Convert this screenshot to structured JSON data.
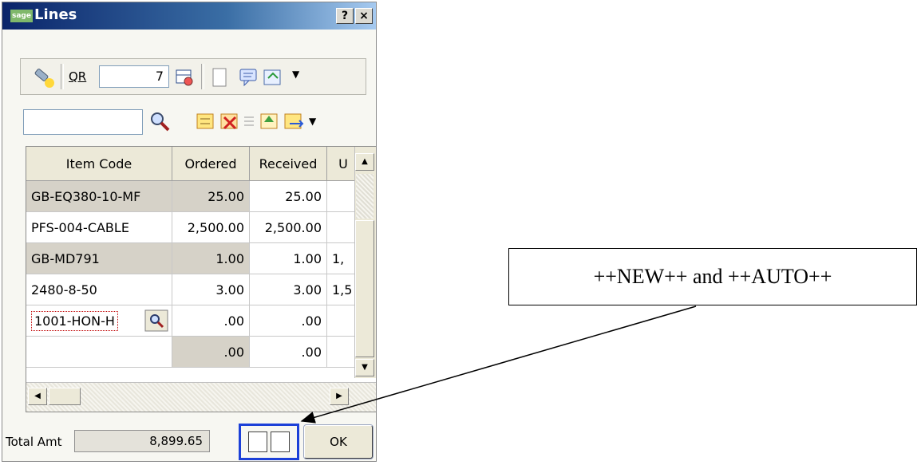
{
  "window": {
    "title": "Lines",
    "logo": "sage",
    "help_label": "?",
    "close_label": "×"
  },
  "toolbar": {
    "qr_label": "QR",
    "qr_value": "7"
  },
  "grid": {
    "columns": [
      "Item Code",
      "Ordered",
      "Received",
      "U"
    ],
    "rows": [
      {
        "code": "GB-EQ380-10-MF",
        "ordered": "25.00",
        "received": "25.00",
        "u": ""
      },
      {
        "code": "PFS-004-CABLE",
        "ordered": "2,500.00",
        "received": "2,500.00",
        "u": ""
      },
      {
        "code": "GB-MD791",
        "ordered": "1.00",
        "received": "1.00",
        "u": "1,"
      },
      {
        "code": "2480-8-50",
        "ordered": "3.00",
        "received": "3.00",
        "u": "1,5"
      },
      {
        "code": "1001-HON-H",
        "ordered": ".00",
        "received": ".00",
        "u": ""
      },
      {
        "code": "",
        "ordered": ".00",
        "received": ".00",
        "u": ""
      }
    ]
  },
  "footer": {
    "total_label": "Total Amt",
    "total_value": "8,899.65",
    "ok_label": "OK"
  },
  "callout": {
    "text": "++NEW++ and ++AUTO++"
  }
}
